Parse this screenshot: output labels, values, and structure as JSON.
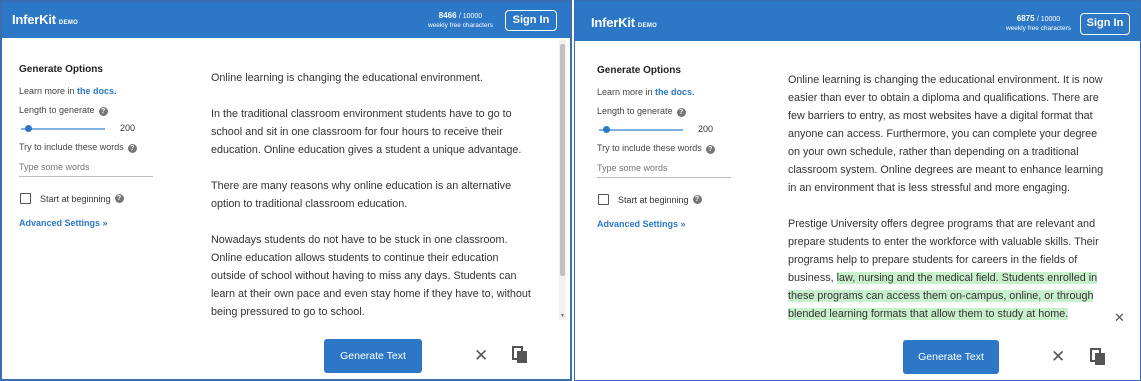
{
  "left": {
    "brand": "InferKit",
    "brand_tag": "DEMO",
    "quota_count": "8466",
    "quota_total": "/ 10000",
    "quota_sub": "weekly free characters",
    "signin": "Sign In",
    "options_title": "Generate Options",
    "learn_prefix": "Learn more in",
    "learn_link": "the docs.",
    "length_label": "Length to generate",
    "length_value": "200",
    "length_fraction": 0.02,
    "words_label": "Try to include these words",
    "words_placeholder": "Type some words",
    "start_label": "Start at beginning",
    "start_checked": false,
    "advanced": "Advanced Settings »",
    "paragraphs": [
      "Online learning is changing the educational environment.",
      "In the traditional classroom environment students have to go to school and sit in one classroom for four hours to receive their education. Online education gives a student a unique advantage.",
      "There are many reasons why online education is an alternative option to traditional classroom education.",
      "Nowadays students do not have to be stuck in one classroom. Online education allows students to continue their education outside of school without having to miss any days. Students can learn at their own pace and even stay home if they have to, without being pressured to go to school."
    ],
    "generate": "Generate Text"
  },
  "right": {
    "brand": "InferKit",
    "brand_tag": "DEMO",
    "quota_count": "6875",
    "quota_total": "/ 10000",
    "quota_sub": "weekly free characters",
    "signin": "Sign In",
    "options_title": "Generate Options",
    "learn_prefix": "Learn more in",
    "learn_link": "the docs.",
    "length_label": "Length to generate",
    "length_value": "200",
    "length_fraction": 0.02,
    "words_label": "Try to include these words",
    "words_placeholder": "Type some words",
    "start_label": "Start at beginning",
    "start_checked": false,
    "advanced": "Advanced Settings »",
    "para1": "Online learning is changing the educational environment. It is now easier than ever to obtain a diploma and qualifications. There are few barriers to entry, as most websites have a digital format that anyone can access. Furthermore, you can complete your degree on your own schedule, rather than depending on a traditional classroom system. Online degrees are meant to enhance learning in an environment that is less stressful and more engaging.",
    "para2_plain": "Prestige University offers degree programs that are relevant and prepare students to enter the workforce with valuable skills. Their programs help to prepare students for careers in the fields of business, ",
    "para2_generated": "law, nursing and the medical field. Students enrolled in these programs can access them on-campus, online, or through blended learning formats that allow them to study at home.",
    "generate": "Generate Text"
  },
  "colors": {
    "brand_blue": "#2c78c6",
    "highlight_green": "#c8f0cc"
  }
}
